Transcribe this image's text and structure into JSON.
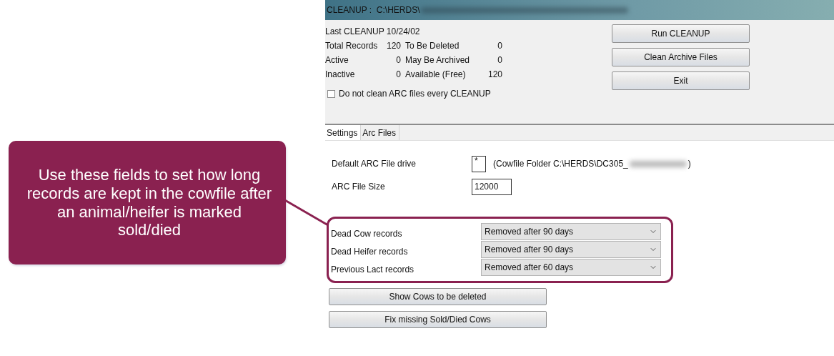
{
  "callout": {
    "text": "Use these fields to set how long records are kept in the cowfile after an animal/heifer is marked sold/died"
  },
  "window": {
    "title": "CLEANUP :  C:\\HERDS\\"
  },
  "summary": {
    "last_cleanup": "Last CLEANUP 10/24/02",
    "rows": [
      {
        "label": "Total Records",
        "value": "120",
        "label2": "To Be Deleted",
        "value2": "0"
      },
      {
        "label": "Active",
        "value": "0",
        "label2": "May Be Archived",
        "value2": "0"
      },
      {
        "label": "Inactive",
        "value": "0",
        "label2": "Available (Free)",
        "value2": "120"
      }
    ]
  },
  "checkbox": {
    "label": "Do not clean ARC files every CLEANUP",
    "checked": false
  },
  "actions": [
    "Run CLEANUP",
    "Clean Archive Files",
    "Exit"
  ],
  "tabs": [
    {
      "label": "Settings",
      "selected": true
    },
    {
      "label": "Arc Files",
      "selected": false
    }
  ],
  "settings": {
    "drive": {
      "label": "Default ARC File drive",
      "value": "*",
      "note_prefix": "(Cowfile Folder C:\\HERDS\\DC305_",
      "note_suffix": ")"
    },
    "size": {
      "label": "ARC File Size",
      "value": "12000"
    }
  },
  "retention": [
    {
      "label": "Dead Cow records",
      "value": "Removed after 90 days"
    },
    {
      "label": "Dead Heifer records",
      "value": "Removed after 90 days"
    },
    {
      "label": "Previous Lact records",
      "value": "Removed after 60 days"
    }
  ],
  "bottom_buttons": [
    "Show Cows to be deleted",
    "Fix missing Sold/Died Cows"
  ]
}
